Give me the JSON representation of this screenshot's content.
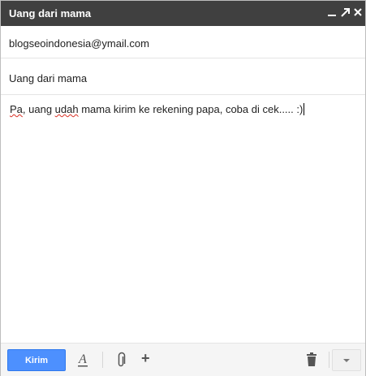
{
  "window": {
    "title": "Uang dari mama"
  },
  "compose": {
    "to": "blogseoindonesia@ymail.com",
    "subject": "Uang dari mama",
    "body_first_word": "Pa",
    "body_middle": ", uang ",
    "body_misspelled": "udah",
    "body_rest": " mama kirim ke rekening papa, coba di cek..... :)"
  },
  "toolbar": {
    "send_label": "Kirim",
    "format_glyph": "A",
    "add_glyph": "+"
  },
  "icons": {
    "minimize": "minimize-icon",
    "popout": "popout-icon",
    "close": "close-icon",
    "formatting": "formatting-icon",
    "attach": "paperclip-icon",
    "insert": "plus-icon",
    "discard": "trash-icon",
    "more": "chevron-down-icon"
  },
  "colors": {
    "titlebar": "#404040",
    "send_button": "#4d90fe",
    "spellcheck": "#d93025"
  }
}
